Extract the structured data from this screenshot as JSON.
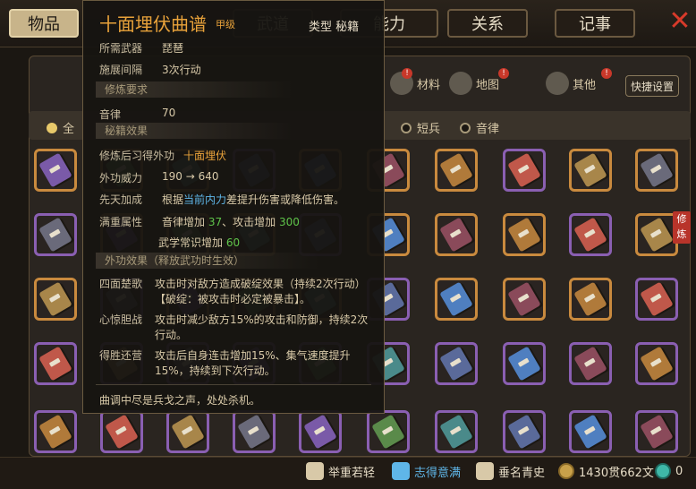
{
  "top_tabs": [
    {
      "label": "物品",
      "active": true
    },
    {
      "label": "武道",
      "active": false
    },
    {
      "label": "能力",
      "active": false
    },
    {
      "label": "关系",
      "active": false
    },
    {
      "label": "记事",
      "active": false
    }
  ],
  "categories": [
    {
      "label": "材料"
    },
    {
      "label": "地图"
    },
    {
      "label": "其他"
    }
  ],
  "quick_settings": "快捷设置",
  "filters": [
    {
      "label": "全",
      "selected": true
    },
    {
      "label": "短兵",
      "selected": false
    },
    {
      "label": "音律",
      "selected": false
    }
  ],
  "xiulian_tag": "修炼",
  "tooltip": {
    "title": "十面埋伏曲谱",
    "grade": "甲级",
    "type_label": "类型",
    "type_value": "秘籍",
    "weapon_label": "所需武器",
    "weapon_value": "琵琶",
    "interval_label": "施展间隔",
    "interval_value": "3次行动",
    "section_requirements": "修炼要求",
    "req_label": "音律",
    "req_value": "70",
    "section_effects": "秘籍效果",
    "learn_label": "修炼后习得外功",
    "learn_value": "十面埋伏",
    "power_label": "外功威力",
    "power_value": "190 → 640",
    "bonus_label": "先天加成",
    "bonus_pre": "根据",
    "bonus_highlight": "当前内力",
    "bonus_post": "差提升伤害或降低伤害。",
    "full_label": "满重属性",
    "full_1_text": "音律增加",
    "full_1_value": "37",
    "full_sep": "、攻击增加",
    "full_2_value": "300",
    "full_3_text": "武学常识增加",
    "full_3_value": "60",
    "section_external": "外功效果（释放武功时生效）",
    "effects": [
      {
        "name": "四面楚歌",
        "desc": "攻击时对敌方造成破绽效果（持续2次行动）【破绽：被攻击时必定被暴击】。"
      },
      {
        "name": "心惊胆战",
        "desc": "攻击时减少敌方15%的攻击和防御，持续2次行动。"
      },
      {
        "name": "得胜还营",
        "desc": "攻击后自身连击增加15%、集气速度提升15%，持续到下次行动。"
      }
    ],
    "flavor": "曲调中尽是兵戈之声，处处杀机。"
  },
  "bottom": {
    "item1": "举重若轻",
    "item2": "志得意满",
    "item3": "垂名青史",
    "money": "1430贯662文",
    "orb_count": "0"
  },
  "colors": {
    "accent_gold": "#e8a23a",
    "positive_green": "#5fc44a",
    "highlight_cyan": "#5fb6e8",
    "rarity_orange": "#c98a3e",
    "rarity_purple": "#8a5fb2"
  }
}
